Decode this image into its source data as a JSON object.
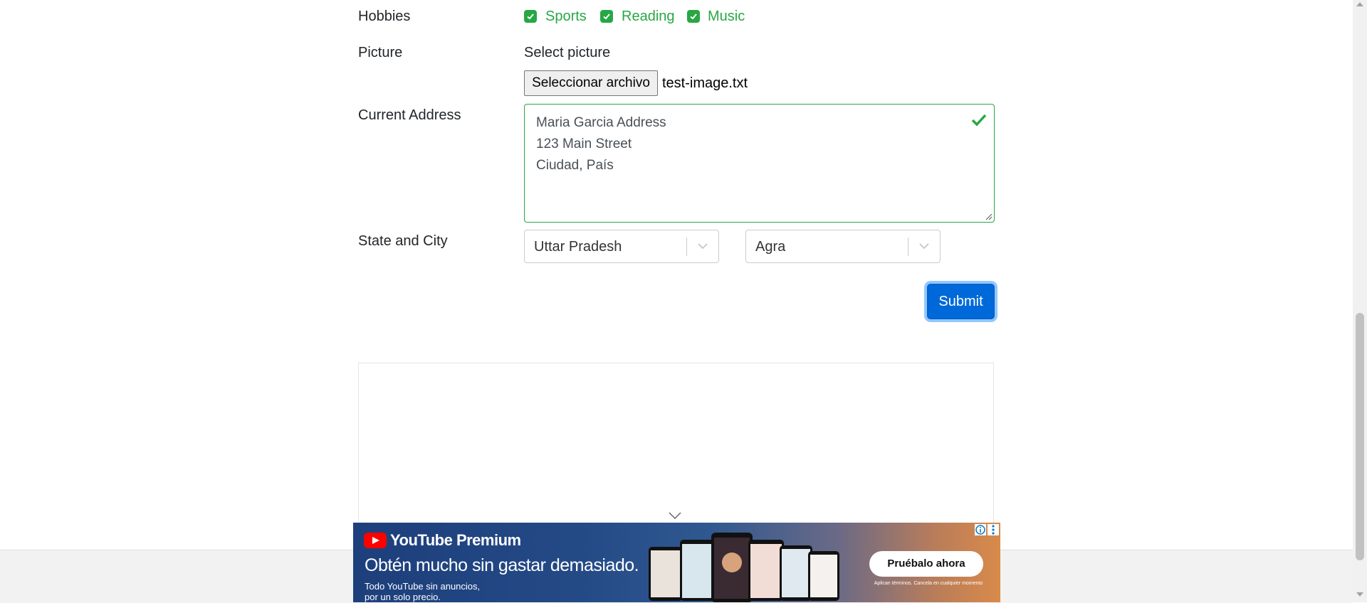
{
  "form": {
    "hobbies_label": "Hobbies",
    "hobbies": [
      {
        "label": "Sports",
        "checked": true
      },
      {
        "label": "Reading",
        "checked": true
      },
      {
        "label": "Music",
        "checked": true
      }
    ],
    "picture_label": "Picture",
    "picture_prompt": "Select picture",
    "file_button_label": "Seleccionar archivo",
    "file_name": "test-image.txt",
    "address_label": "Current Address",
    "address_lines": [
      "Maria Garcia Address",
      "123 Main Street",
      "Ciudad, País"
    ],
    "state_city_label": "State and City",
    "state_value": "Uttar Pradesh",
    "city_value": "Agra",
    "submit_label": "Submit"
  },
  "ad": {
    "brand": "YouTube Premium",
    "headline": "Obtén mucho sin gastar demasiado.",
    "sub_line1": "Todo YouTube sin anuncios,",
    "sub_line2": "por un solo precio.",
    "cta": "Pruébalo ahora",
    "terms": "Aplican términos. Cancela en cualquier momento"
  },
  "colors": {
    "success": "#28a745",
    "primary": "#0069d9",
    "ad_brand": "#ff0000"
  },
  "icons": [
    "check-icon",
    "chevron-down-icon",
    "play-icon",
    "info-icon",
    "more-vertical-icon",
    "resize-handle-icon"
  ]
}
